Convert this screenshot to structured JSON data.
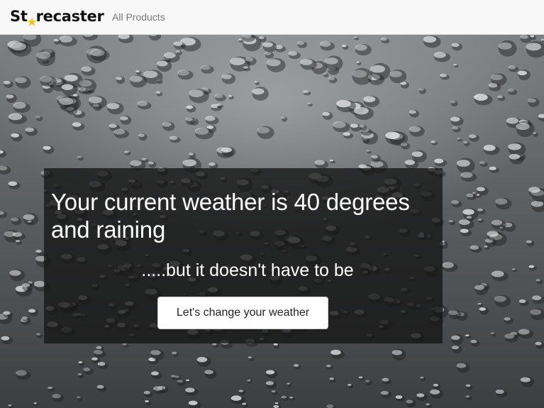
{
  "navbar": {
    "brand_prefix": "St",
    "brand_suffix": "recaster",
    "brand_star_color": "#f2c01c",
    "links": [
      {
        "label": "All Products"
      }
    ]
  },
  "hero": {
    "headline": "Your current weather is 40 degrees and raining",
    "subline": ".....but it doesn't have to be",
    "cta_label": "Let's change your weather"
  }
}
